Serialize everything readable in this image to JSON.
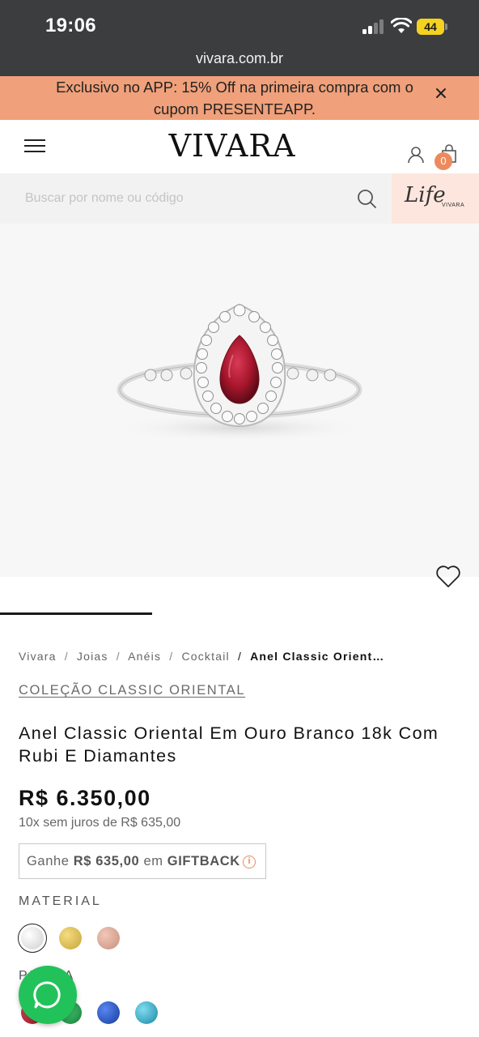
{
  "status_bar": {
    "time": "19:06",
    "battery": "44",
    "url": "vivara.com.br"
  },
  "promo": {
    "text": "Exclusivo no APP: 15% Off na primeira compra com o cupom PRESENTEAPP.",
    "close_icon": "close-icon"
  },
  "header": {
    "logo": "VIVARA",
    "bag_count": "0"
  },
  "search": {
    "placeholder": "Buscar por nome ou código",
    "value": ""
  },
  "life_badge": {
    "script": "Life",
    "brand": "VIVARA"
  },
  "breadcrumb": {
    "items": [
      "Vivara",
      "Joias",
      "Anéis",
      "Cocktail"
    ],
    "separator": "/",
    "current": "Anel Classic Orient…"
  },
  "product": {
    "collection": "COLEÇÃO CLASSIC ORIENTAL",
    "title": "Anel Classic Oriental Em Ouro Branco 18k Com Rubi E Diamantes",
    "price": "R$ 6.350,00",
    "installments": "10x sem juros de R$ 635,00",
    "giftback": {
      "prefix": "Ganhe",
      "amount": "R$ 635,00",
      "middle": "em",
      "label": "GIFTBACK"
    },
    "material_label": "MATERIAL",
    "materials": [
      {
        "name": "ouro-branco",
        "color": "#e2e2e2",
        "selected": true
      },
      {
        "name": "ouro-amarelo",
        "color": "#d8b94a",
        "selected": false
      },
      {
        "name": "ouro-rose",
        "color": "#d9a595",
        "selected": false
      }
    ],
    "stone_label": "PEDRA",
    "stones": [
      {
        "name": "rubi",
        "color": "#b5202c"
      },
      {
        "name": "esmeralda",
        "color": "#1f9a4a"
      },
      {
        "name": "safira",
        "color": "#1f4fc4"
      },
      {
        "name": "topazio",
        "color": "#2fa6c4"
      }
    ]
  },
  "colors": {
    "topbar": "#3b3d3f",
    "promo": "#f0a07a",
    "accent": "#ec8a5e",
    "whatsapp": "#22c25a"
  }
}
